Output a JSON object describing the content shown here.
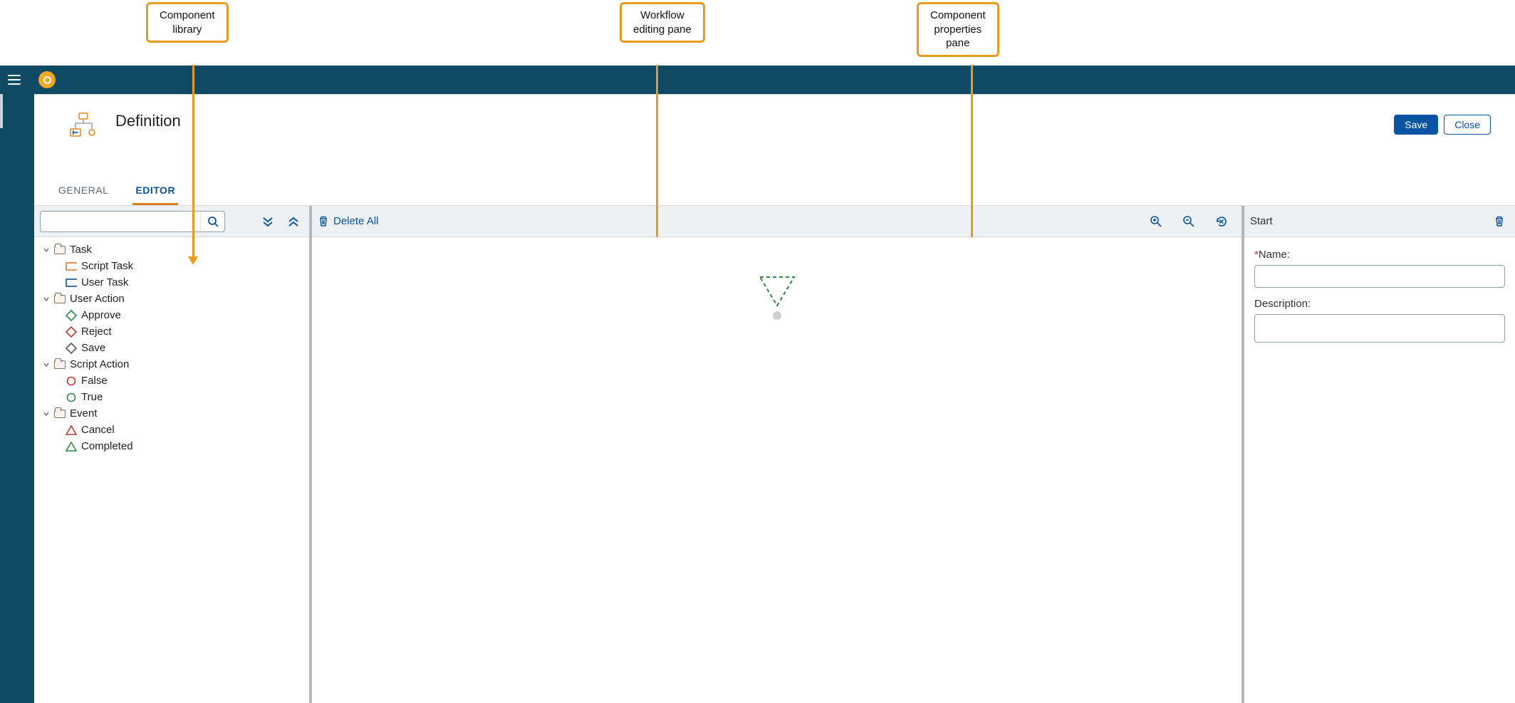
{
  "annotations": {
    "left": "Component\nlibrary",
    "middle": "Workflow\nediting pane",
    "right": "Component\nproperties\npane"
  },
  "header": {
    "title": "Definition",
    "save_label": "Save",
    "close_label": "Close"
  },
  "tabs": [
    {
      "id": "general",
      "label": "GENERAL",
      "active": false
    },
    {
      "id": "editor",
      "label": "EDITOR",
      "active": true
    }
  ],
  "component_library": {
    "search_placeholder": "",
    "groups": [
      {
        "label": "Task",
        "items": [
          {
            "label": "Script Task",
            "shape": "rect",
            "color": "#e2762c"
          },
          {
            "label": "User Task",
            "shape": "rect",
            "color": "#0854a0"
          }
        ]
      },
      {
        "label": "User Action",
        "items": [
          {
            "label": "Approve",
            "shape": "diamond",
            "color": "#2a8a3f"
          },
          {
            "label": "Reject",
            "shape": "diamond",
            "color": "#c0392b"
          },
          {
            "label": "Save",
            "shape": "diamond",
            "color": "#555"
          }
        ]
      },
      {
        "label": "Script Action",
        "items": [
          {
            "label": "False",
            "shape": "circle",
            "color": "#c0392b"
          },
          {
            "label": "True",
            "shape": "circle",
            "color": "#2a8a3f"
          }
        ]
      },
      {
        "label": "Event",
        "items": [
          {
            "label": "Cancel",
            "shape": "triangle",
            "color": "#c0392b"
          },
          {
            "label": "Completed",
            "shape": "triangle",
            "color": "#2a8a3f"
          }
        ]
      }
    ]
  },
  "canvas_toolbar": {
    "delete_all_label": "Delete All"
  },
  "properties": {
    "panel_title": "Start",
    "name_label": "Name:",
    "name_value": "",
    "description_label": "Description:",
    "description_value": ""
  }
}
